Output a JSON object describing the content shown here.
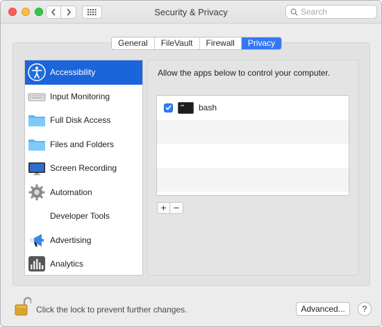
{
  "window": {
    "title": "Security & Privacy"
  },
  "search": {
    "placeholder": "Search",
    "value": ""
  },
  "tabs": [
    {
      "label": "General",
      "active": false
    },
    {
      "label": "FileVault",
      "active": false
    },
    {
      "label": "Firewall",
      "active": false
    },
    {
      "label": "Privacy",
      "active": true
    }
  ],
  "sidebar": {
    "items": [
      {
        "label": "Accessibility",
        "icon": "accessibility-icon",
        "selected": true
      },
      {
        "label": "Input Monitoring",
        "icon": "keyboard-icon",
        "selected": false
      },
      {
        "label": "Full Disk Access",
        "icon": "folder-icon",
        "selected": false
      },
      {
        "label": "Files and Folders",
        "icon": "folder-icon",
        "selected": false
      },
      {
        "label": "Screen Recording",
        "icon": "display-icon",
        "selected": false
      },
      {
        "label": "Automation",
        "icon": "gear-icon",
        "selected": false
      },
      {
        "label": "Developer Tools",
        "icon": "",
        "selected": false
      },
      {
        "label": "Advertising",
        "icon": "megaphone-icon",
        "selected": false
      },
      {
        "label": "Analytics",
        "icon": "analytics-icon",
        "selected": false
      }
    ]
  },
  "main": {
    "description": "Allow the apps below to control your computer.",
    "apps": [
      {
        "name": "bash",
        "checked": true,
        "icon": "terminal-icon"
      }
    ],
    "add_label": "+",
    "remove_label": "−"
  },
  "footer": {
    "lock_text": "Click the lock to prevent further changes.",
    "advanced_label": "Advanced...",
    "help_label": "?"
  },
  "colors": {
    "accent": "#3478f6",
    "selection": "#1c64d9"
  }
}
